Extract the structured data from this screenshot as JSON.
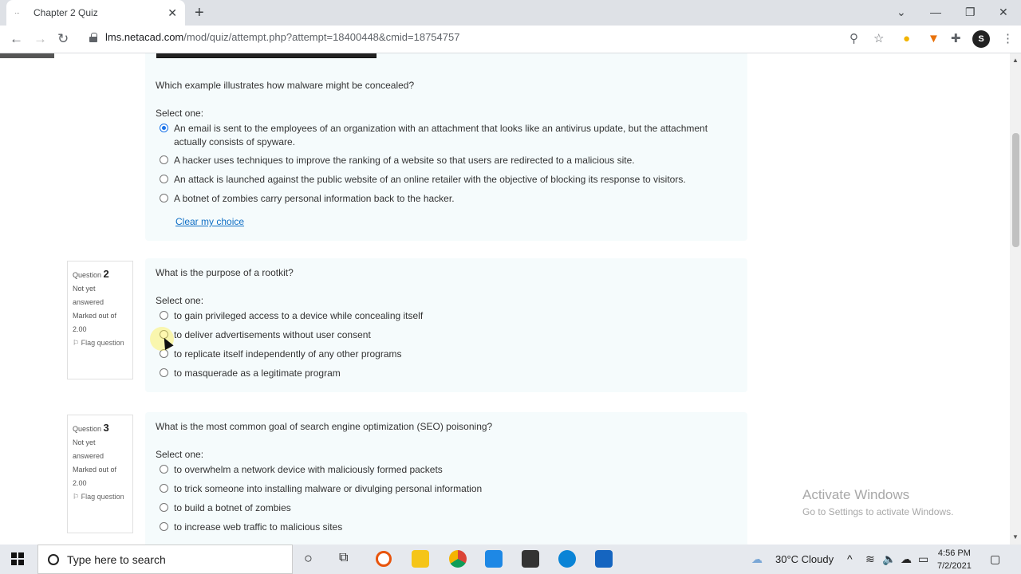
{
  "browser": {
    "tab_title": "Chapter 2 Quiz",
    "tab_favicon": "···",
    "url_domain": "lms.netacad.com",
    "url_path": "/mod/quiz/attempt.php?attempt=18400448&cmid=18754757",
    "profile_initial": "S"
  },
  "questions": [
    {
      "text": "Which example illustrates how malware might be concealed?",
      "select_label": "Select one:",
      "options": [
        "An email is sent to the employees of an organization with an attachment that looks like an antivirus update, but the attachment actually consists of spyware.",
        "A hacker uses techniques to improve the ranking of a website so that users are redirected to a malicious site.",
        "An attack is launched against the public website of an online retailer with the objective of blocking its response to visitors.",
        "A botnet of zombies carry personal information back to the hacker."
      ],
      "selected_index": 0,
      "clear_label": "Clear my choice"
    },
    {
      "info": {
        "label": "Question",
        "number": "2",
        "status": "Not yet answered",
        "marked": "Marked out of 2.00",
        "flag": "Flag question"
      },
      "text": "What is the purpose of a rootkit?",
      "select_label": "Select one:",
      "options": [
        "to gain privileged access to a device while concealing itself",
        "to deliver advertisements without user consent",
        "to replicate itself independently of any other programs",
        "to masquerade as a legitimate program"
      ]
    },
    {
      "info": {
        "label": "Question",
        "number": "3",
        "status": "Not yet answered",
        "marked": "Marked out of 2.00",
        "flag": "Flag question"
      },
      "text": "What is the most common goal of search engine optimization (SEO) poisoning?",
      "select_label": "Select one:",
      "options": [
        "to overwhelm a network device with maliciously formed packets",
        "to trick someone into installing malware or divulging personal information",
        "to build a botnet of zombies",
        "to increase web traffic to malicious sites"
      ]
    }
  ],
  "watermark": {
    "line1": "Activate Windows",
    "line2": "Go to Settings to activate Windows."
  },
  "taskbar": {
    "search_placeholder": "Type here to search",
    "weather": "30°C  Cloudy",
    "time": "4:56 PM",
    "date": "7/2/2021"
  },
  "colors": {
    "accent": "#1a73e8",
    "link": "#0f6fc5",
    "card_bg": "#f5fbfc"
  }
}
